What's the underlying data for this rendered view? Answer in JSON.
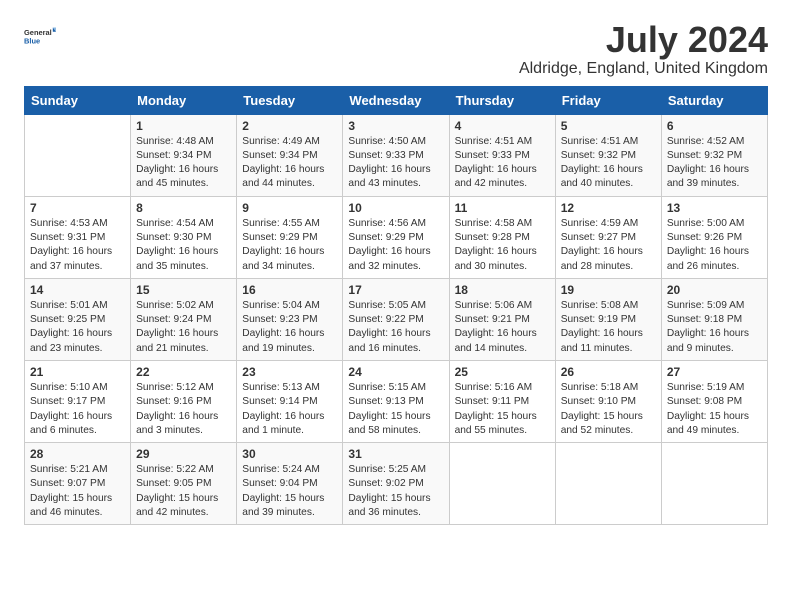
{
  "logo": {
    "general": "General",
    "blue": "Blue"
  },
  "header": {
    "title": "July 2024",
    "subtitle": "Aldridge, England, United Kingdom"
  },
  "weekdays": [
    "Sunday",
    "Monday",
    "Tuesday",
    "Wednesday",
    "Thursday",
    "Friday",
    "Saturday"
  ],
  "weeks": [
    [
      {
        "day": "",
        "sunrise": "",
        "sunset": "",
        "daylight": ""
      },
      {
        "day": "1",
        "sunrise": "Sunrise: 4:48 AM",
        "sunset": "Sunset: 9:34 PM",
        "daylight": "Daylight: 16 hours and 45 minutes."
      },
      {
        "day": "2",
        "sunrise": "Sunrise: 4:49 AM",
        "sunset": "Sunset: 9:34 PM",
        "daylight": "Daylight: 16 hours and 44 minutes."
      },
      {
        "day": "3",
        "sunrise": "Sunrise: 4:50 AM",
        "sunset": "Sunset: 9:33 PM",
        "daylight": "Daylight: 16 hours and 43 minutes."
      },
      {
        "day": "4",
        "sunrise": "Sunrise: 4:51 AM",
        "sunset": "Sunset: 9:33 PM",
        "daylight": "Daylight: 16 hours and 42 minutes."
      },
      {
        "day": "5",
        "sunrise": "Sunrise: 4:51 AM",
        "sunset": "Sunset: 9:32 PM",
        "daylight": "Daylight: 16 hours and 40 minutes."
      },
      {
        "day": "6",
        "sunrise": "Sunrise: 4:52 AM",
        "sunset": "Sunset: 9:32 PM",
        "daylight": "Daylight: 16 hours and 39 minutes."
      }
    ],
    [
      {
        "day": "7",
        "sunrise": "Sunrise: 4:53 AM",
        "sunset": "Sunset: 9:31 PM",
        "daylight": "Daylight: 16 hours and 37 minutes."
      },
      {
        "day": "8",
        "sunrise": "Sunrise: 4:54 AM",
        "sunset": "Sunset: 9:30 PM",
        "daylight": "Daylight: 16 hours and 35 minutes."
      },
      {
        "day": "9",
        "sunrise": "Sunrise: 4:55 AM",
        "sunset": "Sunset: 9:29 PM",
        "daylight": "Daylight: 16 hours and 34 minutes."
      },
      {
        "day": "10",
        "sunrise": "Sunrise: 4:56 AM",
        "sunset": "Sunset: 9:29 PM",
        "daylight": "Daylight: 16 hours and 32 minutes."
      },
      {
        "day": "11",
        "sunrise": "Sunrise: 4:58 AM",
        "sunset": "Sunset: 9:28 PM",
        "daylight": "Daylight: 16 hours and 30 minutes."
      },
      {
        "day": "12",
        "sunrise": "Sunrise: 4:59 AM",
        "sunset": "Sunset: 9:27 PM",
        "daylight": "Daylight: 16 hours and 28 minutes."
      },
      {
        "day": "13",
        "sunrise": "Sunrise: 5:00 AM",
        "sunset": "Sunset: 9:26 PM",
        "daylight": "Daylight: 16 hours and 26 minutes."
      }
    ],
    [
      {
        "day": "14",
        "sunrise": "Sunrise: 5:01 AM",
        "sunset": "Sunset: 9:25 PM",
        "daylight": "Daylight: 16 hours and 23 minutes."
      },
      {
        "day": "15",
        "sunrise": "Sunrise: 5:02 AM",
        "sunset": "Sunset: 9:24 PM",
        "daylight": "Daylight: 16 hours and 21 minutes."
      },
      {
        "day": "16",
        "sunrise": "Sunrise: 5:04 AM",
        "sunset": "Sunset: 9:23 PM",
        "daylight": "Daylight: 16 hours and 19 minutes."
      },
      {
        "day": "17",
        "sunrise": "Sunrise: 5:05 AM",
        "sunset": "Sunset: 9:22 PM",
        "daylight": "Daylight: 16 hours and 16 minutes."
      },
      {
        "day": "18",
        "sunrise": "Sunrise: 5:06 AM",
        "sunset": "Sunset: 9:21 PM",
        "daylight": "Daylight: 16 hours and 14 minutes."
      },
      {
        "day": "19",
        "sunrise": "Sunrise: 5:08 AM",
        "sunset": "Sunset: 9:19 PM",
        "daylight": "Daylight: 16 hours and 11 minutes."
      },
      {
        "day": "20",
        "sunrise": "Sunrise: 5:09 AM",
        "sunset": "Sunset: 9:18 PM",
        "daylight": "Daylight: 16 hours and 9 minutes."
      }
    ],
    [
      {
        "day": "21",
        "sunrise": "Sunrise: 5:10 AM",
        "sunset": "Sunset: 9:17 PM",
        "daylight": "Daylight: 16 hours and 6 minutes."
      },
      {
        "day": "22",
        "sunrise": "Sunrise: 5:12 AM",
        "sunset": "Sunset: 9:16 PM",
        "daylight": "Daylight: 16 hours and 3 minutes."
      },
      {
        "day": "23",
        "sunrise": "Sunrise: 5:13 AM",
        "sunset": "Sunset: 9:14 PM",
        "daylight": "Daylight: 16 hours and 1 minute."
      },
      {
        "day": "24",
        "sunrise": "Sunrise: 5:15 AM",
        "sunset": "Sunset: 9:13 PM",
        "daylight": "Daylight: 15 hours and 58 minutes."
      },
      {
        "day": "25",
        "sunrise": "Sunrise: 5:16 AM",
        "sunset": "Sunset: 9:11 PM",
        "daylight": "Daylight: 15 hours and 55 minutes."
      },
      {
        "day": "26",
        "sunrise": "Sunrise: 5:18 AM",
        "sunset": "Sunset: 9:10 PM",
        "daylight": "Daylight: 15 hours and 52 minutes."
      },
      {
        "day": "27",
        "sunrise": "Sunrise: 5:19 AM",
        "sunset": "Sunset: 9:08 PM",
        "daylight": "Daylight: 15 hours and 49 minutes."
      }
    ],
    [
      {
        "day": "28",
        "sunrise": "Sunrise: 5:21 AM",
        "sunset": "Sunset: 9:07 PM",
        "daylight": "Daylight: 15 hours and 46 minutes."
      },
      {
        "day": "29",
        "sunrise": "Sunrise: 5:22 AM",
        "sunset": "Sunset: 9:05 PM",
        "daylight": "Daylight: 15 hours and 42 minutes."
      },
      {
        "day": "30",
        "sunrise": "Sunrise: 5:24 AM",
        "sunset": "Sunset: 9:04 PM",
        "daylight": "Daylight: 15 hours and 39 minutes."
      },
      {
        "day": "31",
        "sunrise": "Sunrise: 5:25 AM",
        "sunset": "Sunset: 9:02 PM",
        "daylight": "Daylight: 15 hours and 36 minutes."
      },
      {
        "day": "",
        "sunrise": "",
        "sunset": "",
        "daylight": ""
      },
      {
        "day": "",
        "sunrise": "",
        "sunset": "",
        "daylight": ""
      },
      {
        "day": "",
        "sunrise": "",
        "sunset": "",
        "daylight": ""
      }
    ]
  ]
}
